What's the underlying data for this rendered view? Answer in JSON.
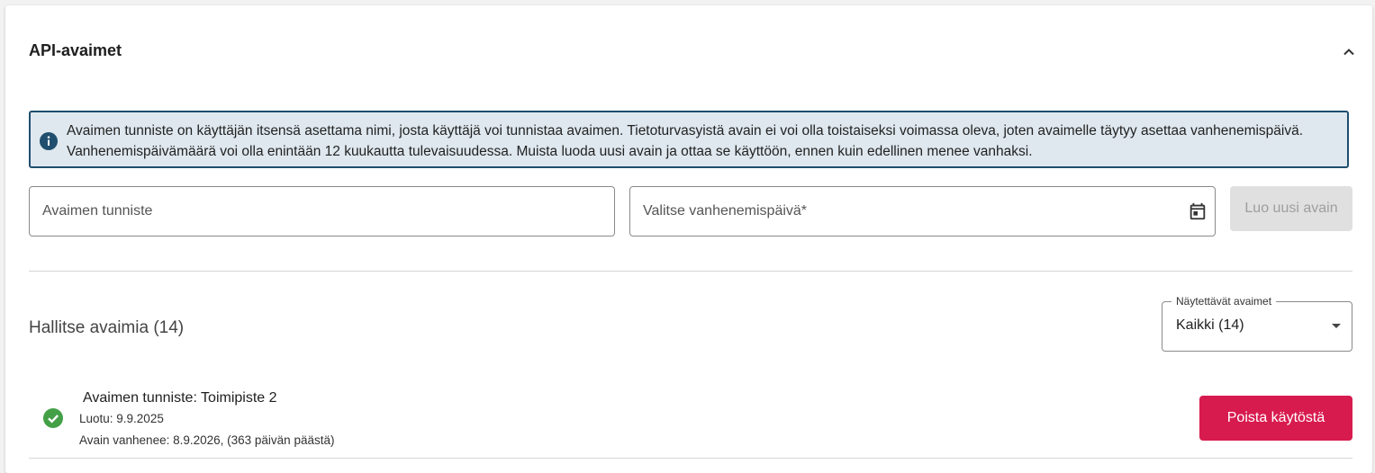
{
  "section": {
    "title": "API-avaimet"
  },
  "info": {
    "text": "Avaimen tunniste on käyttäjän itsensä asettama nimi, josta käyttäjä voi tunnistaa avaimen. Tietoturvasyistä avain ei voi olla toistaiseksi voimassa oleva, joten avaimelle täytyy asettaa vanhenemispäivä. Vanhenemispäivämäärä voi olla enintään 12 kuukautta tulevaisuudessa. Muista luoda uusi avain ja ottaa se käyttöön, ennen kuin edellinen menee vanhaksi."
  },
  "form": {
    "key_name_placeholder": "Avaimen tunniste",
    "key_name_value": "",
    "expiry_placeholder": "Valitse vanhenemispäivä*",
    "expiry_value": "",
    "create_button_label": "Luo uusi avain",
    "create_button_disabled": true
  },
  "manage": {
    "title": "Hallitse avaimia (14)",
    "filter": {
      "label": "Näytettävät avaimet",
      "selected": "Kaikki (14)"
    },
    "keys": [
      {
        "name": "Avaimen tunniste: Toimipiste 2",
        "created": "Luotu: 9.9.2025",
        "expires": "Avain vanhenee: 8.9.2026, (363 päivän päästä)",
        "status": "active",
        "action_label": "Poista käytöstä"
      }
    ]
  },
  "icons": {
    "collapse": "chevron-up-icon",
    "info": "info-icon",
    "calendar": "calendar-icon",
    "status": "check-circle-icon",
    "dropdown": "dropdown-arrow-icon"
  },
  "colors": {
    "info_border": "#1f4e6e",
    "info_background": "#dfe8ef",
    "success": "#43a047",
    "danger_button": "#d81b4f",
    "disabled_button": "#e0e0e0"
  }
}
